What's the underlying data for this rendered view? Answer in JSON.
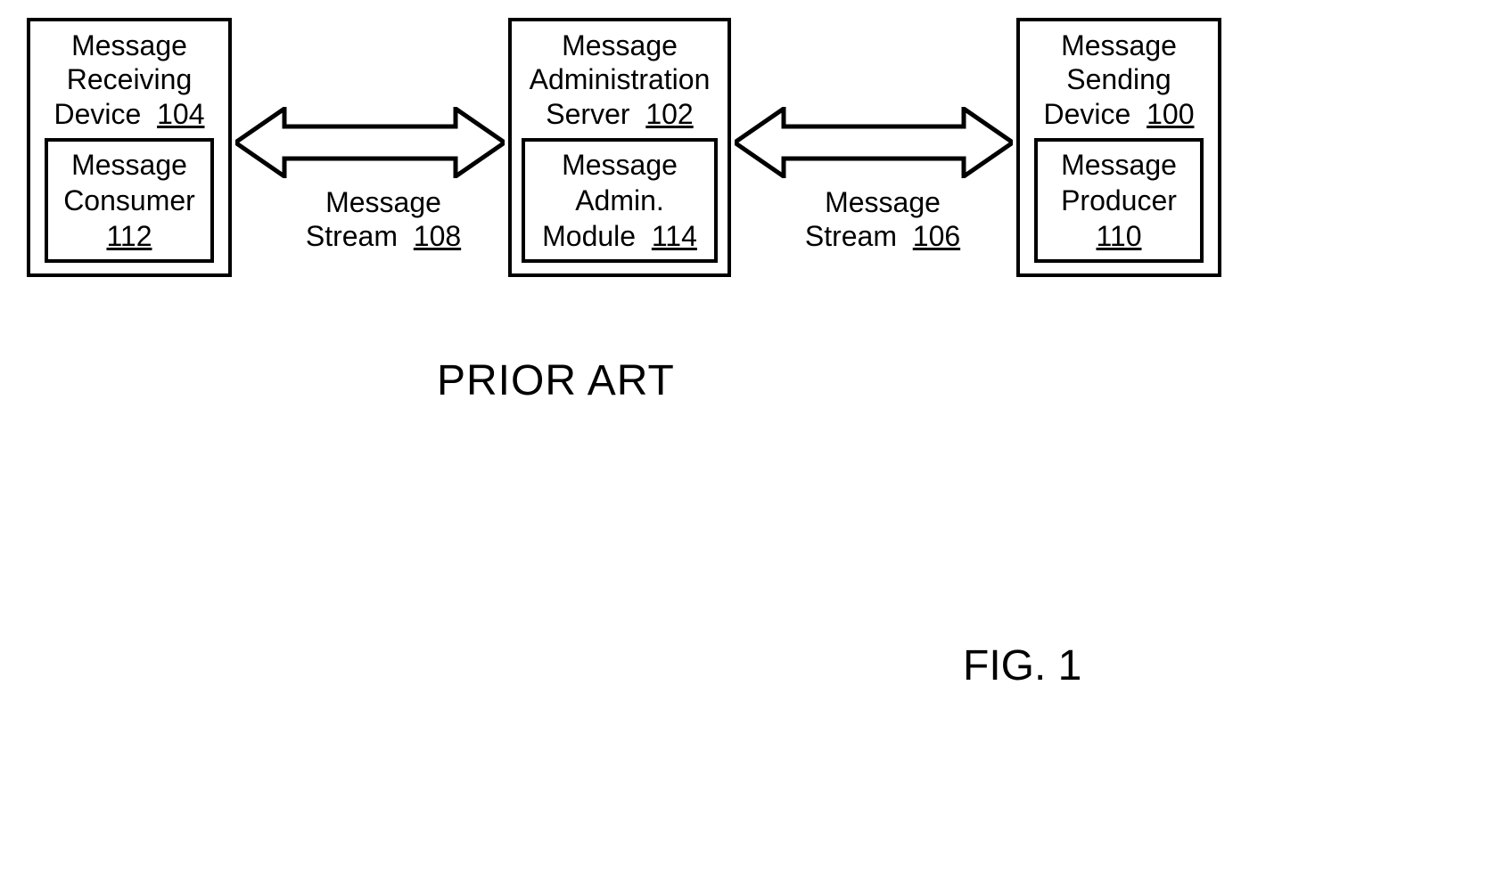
{
  "box_left": {
    "line1": "Message",
    "line2": "Receiving",
    "line3_text": "Device",
    "line3_ref": "104",
    "inner_line1": "Message",
    "inner_line2": "Consumer",
    "inner_ref": "112"
  },
  "box_mid": {
    "line1": "Message",
    "line2": "Administration",
    "line3_text": "Server",
    "line3_ref": "102",
    "inner_line1": "Message",
    "inner_line2": "Admin.",
    "inner_line3_text": "Module",
    "inner_ref": "114"
  },
  "box_right": {
    "line1": "Message",
    "line2": "Sending",
    "line3_text": "Device",
    "line3_ref": "100",
    "inner_line1": "Message",
    "inner_line2": "Producer",
    "inner_ref": "110"
  },
  "arrow_left": {
    "label_line1": "Message",
    "label_line2_text": "Stream",
    "label_ref": "108"
  },
  "arrow_right": {
    "label_line1": "Message",
    "label_line2_text": "Stream",
    "label_ref": "106"
  },
  "caption": "PRIOR ART",
  "figure": "FIG. 1"
}
